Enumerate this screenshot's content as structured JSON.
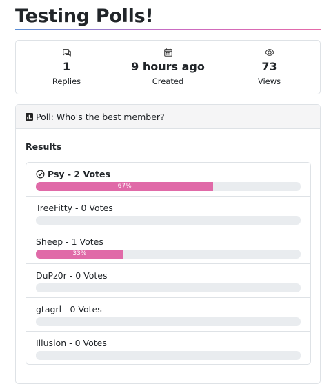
{
  "topic": {
    "title": "Testing Polls!"
  },
  "stats": [
    {
      "icon": "chat-bubbles-icon",
      "value": "1",
      "label": "Replies"
    },
    {
      "icon": "calendar-icon",
      "value": "9 hours ago",
      "label": "Created"
    },
    {
      "icon": "eye-icon",
      "value": "73",
      "label": "Views"
    }
  ],
  "poll": {
    "header": "Poll: Who's the best member?",
    "results_label": "Results",
    "accent_color": "#e06aa8",
    "options": [
      {
        "label": "Psy - 2 Votes",
        "percent": 67,
        "percent_label": "67%",
        "winner": true
      },
      {
        "label": "TreeFitty - 0 Votes",
        "percent": 0,
        "percent_label": "",
        "winner": false
      },
      {
        "label": "Sheep - 1 Votes",
        "percent": 33,
        "percent_label": "33%",
        "winner": false
      },
      {
        "label": "DuPz0r - 0 Votes",
        "percent": 0,
        "percent_label": "",
        "winner": false
      },
      {
        "label": "gtagrl - 0 Votes",
        "percent": 0,
        "percent_label": "",
        "winner": false
      },
      {
        "label": "Illusion - 0 Votes",
        "percent": 0,
        "percent_label": "",
        "winner": false
      }
    ]
  }
}
